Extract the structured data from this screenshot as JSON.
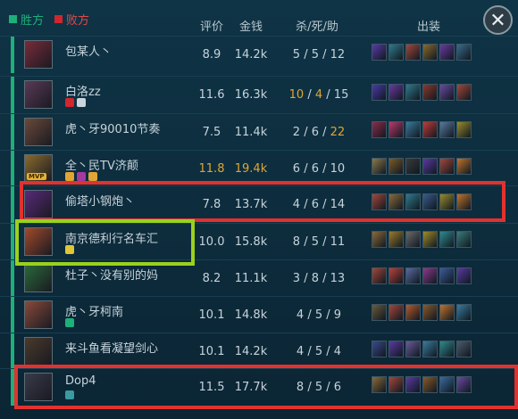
{
  "legend": {
    "win": "胜方",
    "lose": "败方"
  },
  "columns": {
    "rating": "评价",
    "gold": "金钱",
    "kda": "杀/死/助",
    "items": "出装"
  },
  "close_icon": "close-icon",
  "colors": {
    "win": "#1db07a",
    "lose": "#d0262c",
    "highlight_gold": "#e0a535",
    "box_red": "#e1322f",
    "box_green": "#9bd11c"
  },
  "players": [
    {
      "name": "包某人丶",
      "rating": "8.9",
      "gold": "14.2k",
      "k": "5",
      "d": "5",
      "a": "12",
      "badges": [],
      "champ_color": "#7a2b3a",
      "items": [
        "#5a3aa8",
        "#2f7a8c",
        "#a3473a",
        "#8b6a2c",
        "#6a3aa0",
        "#3a6a8a"
      ]
    },
    {
      "name": "白洛zz",
      "rating": "11.6",
      "gold": "16.3k",
      "k": "10",
      "d": "4",
      "a": "15",
      "k_hl": true,
      "d_hl": true,
      "badges": [
        "#d0262c",
        "#c9d6dd"
      ],
      "champ_color": "#5a3a56",
      "items": [
        "#4a3aa8",
        "#6a3aa0",
        "#2f7a8c",
        "#8b3a2c",
        "#6a4aa0",
        "#a3473a"
      ]
    },
    {
      "name": "虎丶牙90010节奏",
      "rating": "7.5",
      "gold": "11.4k",
      "k": "2",
      "d": "6",
      "a": "22",
      "a_hl": true,
      "badges": [],
      "champ_color": "#6b4a3a",
      "items": [
        "#8b2c4a",
        "#b83a6a",
        "#3a7a9c",
        "#c03a3a",
        "#5a7aa0",
        "#9a8a2c"
      ]
    },
    {
      "name": "全丶民TV济颠",
      "rating": "11.8",
      "gold": "19.4k",
      "k": "6",
      "d": "6",
      "a": "10",
      "rating_hl": true,
      "gold_hl": true,
      "mvp": "MVP",
      "badges": [
        "#e0a535",
        "#a33aa0",
        "#e0a535"
      ],
      "champ_color": "#8a6a2c",
      "items": [
        "#8a7a4a",
        "#7a5a2a",
        "#3a3a3a",
        "#5a3aa0",
        "#a3473a",
        "#c0732c"
      ]
    },
    {
      "name": "偷塔小钢炮丶",
      "rating": "7.8",
      "gold": "13.7k",
      "k": "4",
      "d": "6",
      "a": "14",
      "badges": [],
      "champ_color": "#5a2a7a",
      "items": [
        "#a3473a",
        "#8a6a3a",
        "#2f7a8c",
        "#3a5a8a",
        "#9a8a2c",
        "#c0732c"
      ]
    },
    {
      "name": "南京德利行名车汇",
      "rating": "10.0",
      "gold": "15.8k",
      "k": "8",
      "d": "5",
      "a": "11",
      "badges": [
        "#e0c535"
      ],
      "champ_color": "#a34a2a",
      "items": [
        "#8a6a3a",
        "#9a7a2c",
        "#6a6a6a",
        "#a08a2c",
        "#2f8a8c",
        "#3a7a7a"
      ]
    },
    {
      "name": "杜子丶没有别的妈",
      "rating": "8.2",
      "gold": "11.1k",
      "k": "3",
      "d": "8",
      "a": "13",
      "badges": [],
      "champ_color": "#2a6a3a",
      "items": [
        "#a3473a",
        "#b8403a",
        "#5a6aa0",
        "#8b3a8a",
        "#3a5a9a",
        "#5a3aa0"
      ]
    },
    {
      "name": "虎丶牙柯南",
      "rating": "10.1",
      "gold": "14.8k",
      "k": "4",
      "d": "5",
      "a": "9",
      "badges": [
        "#1db07a"
      ],
      "champ_color": "#8a4a3a",
      "items": [
        "#6a5a3a",
        "#a3473a",
        "#b85a2a",
        "#8a5a2a",
        "#c0732c",
        "#3a7a9c"
      ]
    },
    {
      "name": "来斗鱼看凝望剑心",
      "rating": "10.1",
      "gold": "14.2k",
      "k": "4",
      "d": "5",
      "a": "4",
      "badges": [],
      "champ_color": "#4a3a2a",
      "items": [
        "#3a4a8a",
        "#5a3aa0",
        "#6a5a9a",
        "#3a7a9c",
        "#2f8a8c",
        "#4a5a6a"
      ]
    },
    {
      "name": "Dop4",
      "rating": "11.5",
      "gold": "17.7k",
      "k": "8",
      "d": "5",
      "a": "6",
      "badges": [
        "#3a9aa0"
      ],
      "champ_color": "#3a3a4a",
      "items": [
        "#8a6a3a",
        "#a3473a",
        "#5a3aa0",
        "#8a5a2a",
        "#3a6a9c",
        "#6a4aa0"
      ]
    }
  ]
}
